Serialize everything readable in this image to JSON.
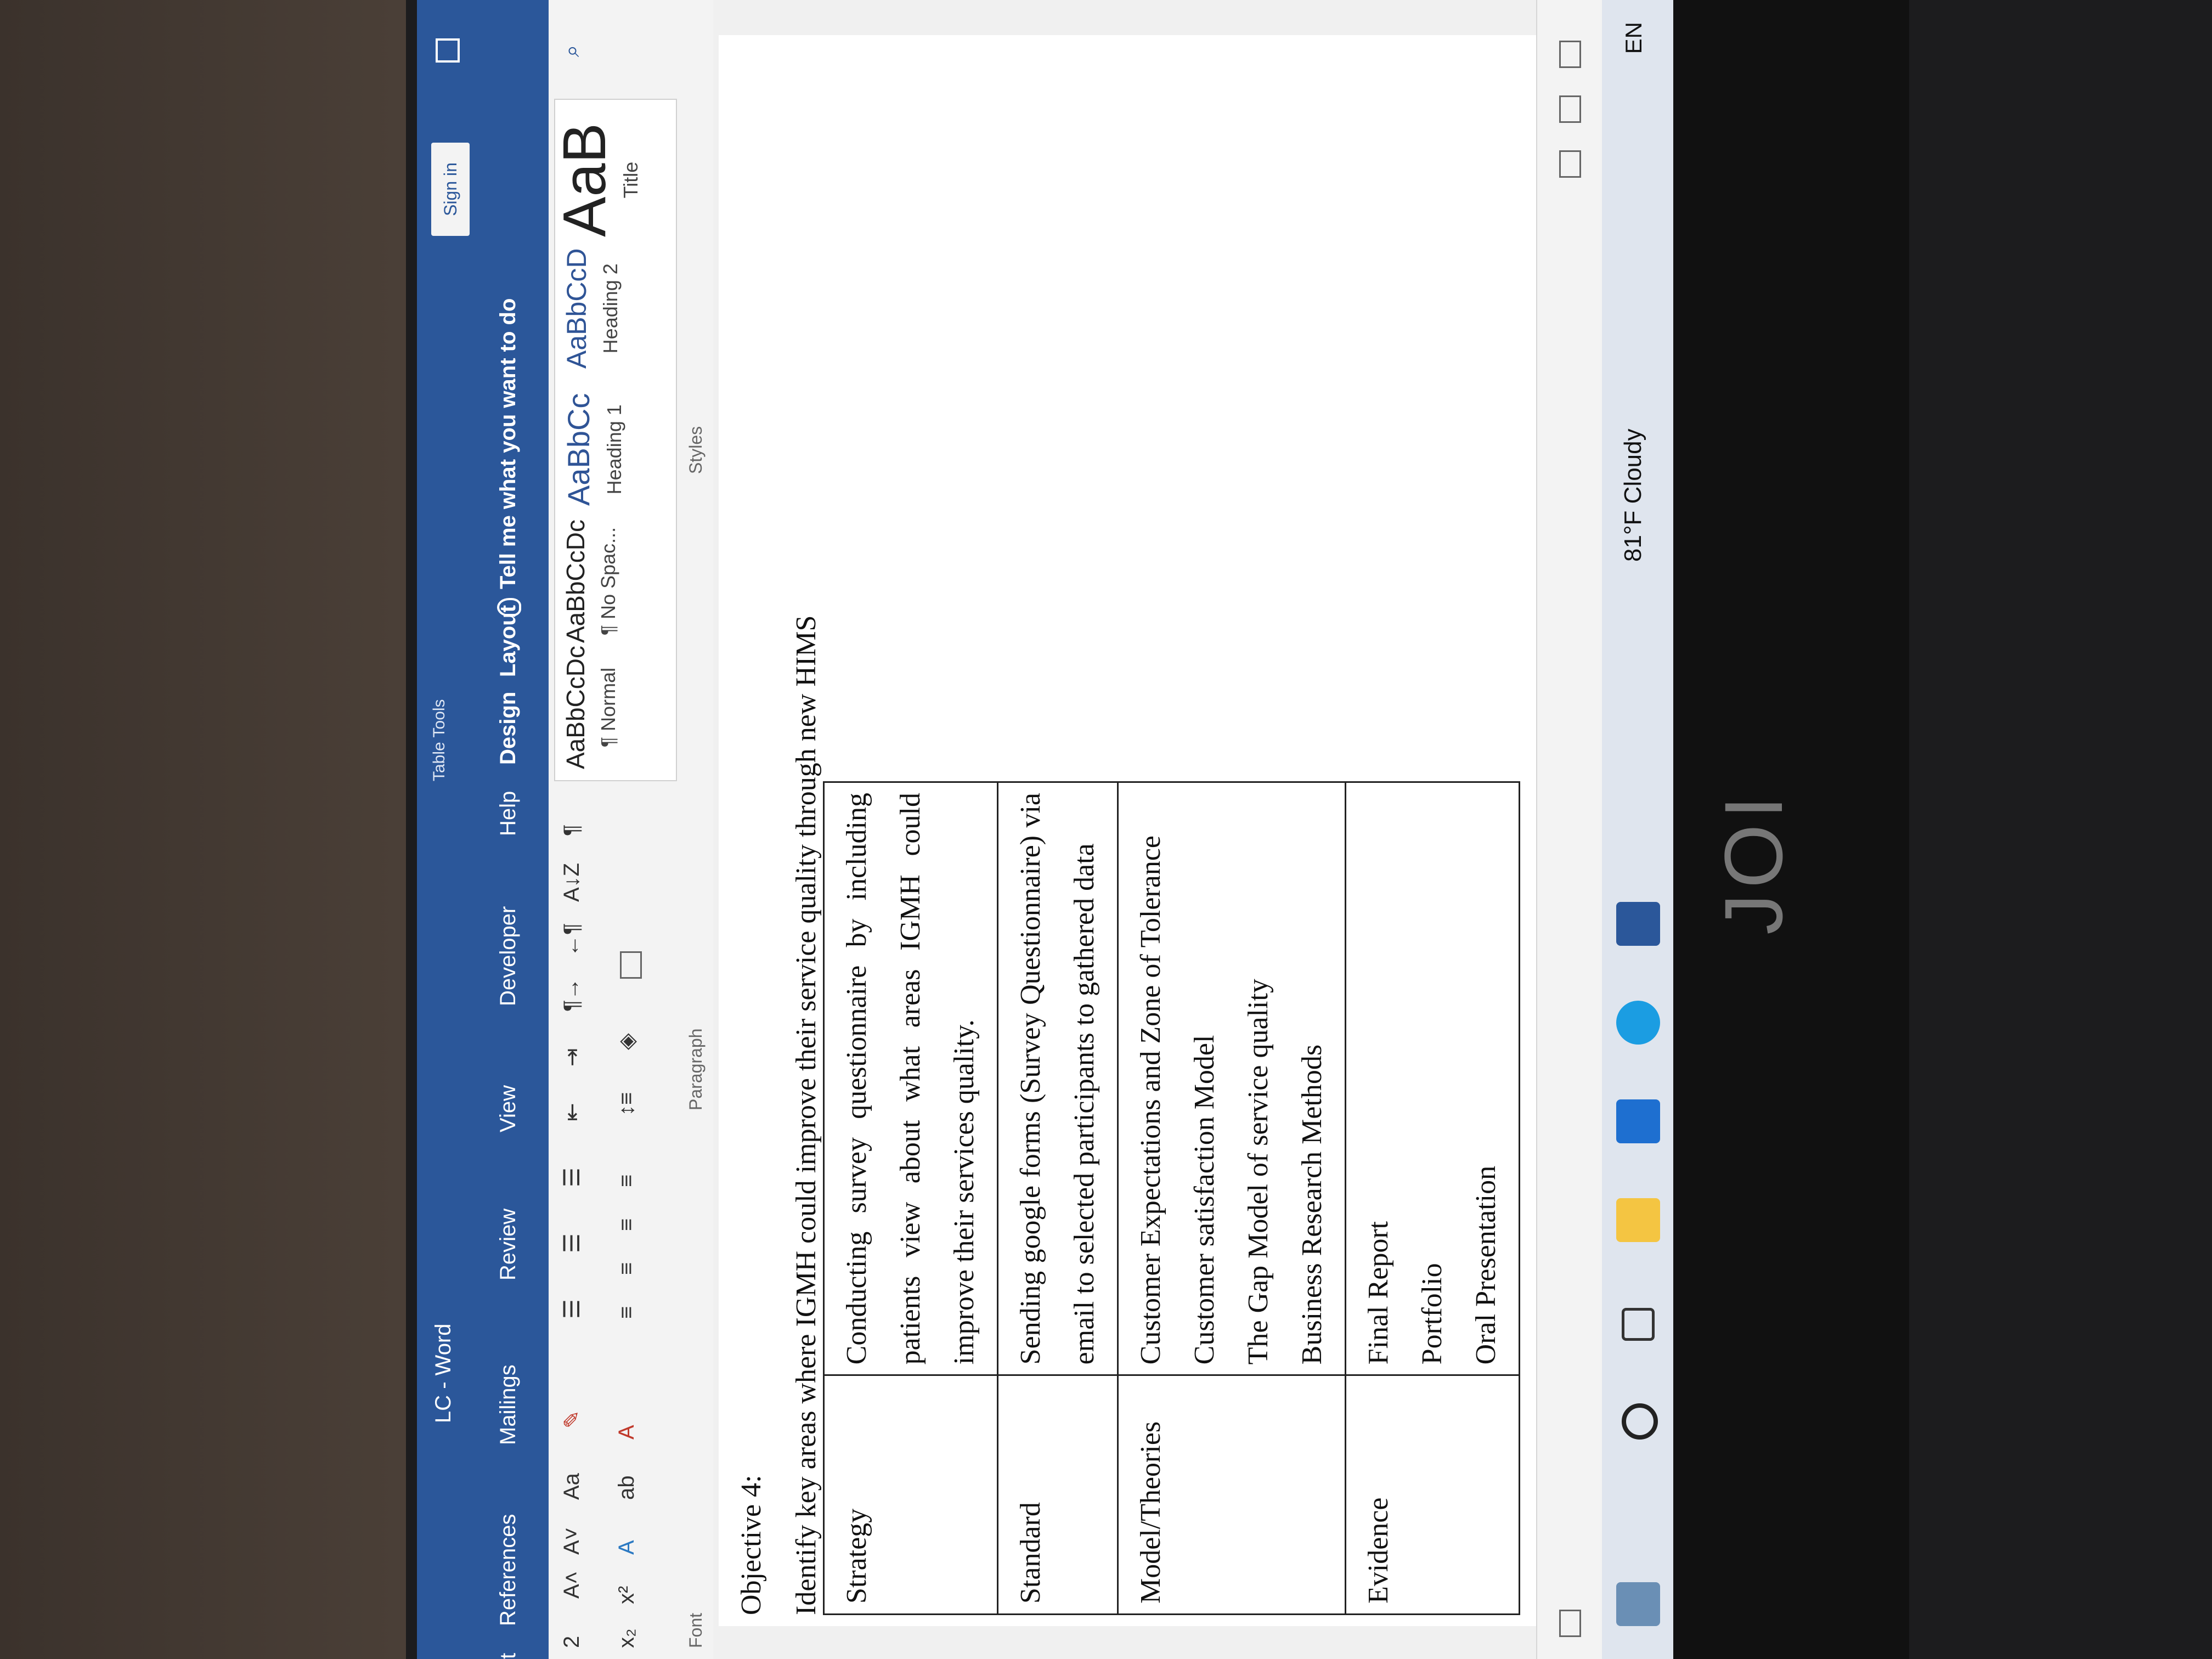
{
  "window": {
    "title": "LC - Word",
    "context_group": "Table Tools",
    "sign_in": "Sign in"
  },
  "tabs": [
    {
      "label": "t"
    },
    {
      "label": "References"
    },
    {
      "label": "Mailings"
    },
    {
      "label": "Review"
    },
    {
      "label": "View"
    },
    {
      "label": "Developer"
    },
    {
      "label": "Help"
    },
    {
      "label": "Design"
    },
    {
      "label": "Layout"
    }
  ],
  "tell_me": "Tell me what you want to do",
  "ribbon": {
    "font_size": "2",
    "case_label": "Aa",
    "font_group": "Font",
    "paragraph_group": "Paragraph",
    "styles_group": "Styles",
    "styles": [
      {
        "sample": "AaBbCcDc",
        "name": "¶ Normal"
      },
      {
        "sample": "AaBbCcDc",
        "name": "¶ No Spac..."
      },
      {
        "sample": "AaBbCc",
        "name": "Heading 1"
      },
      {
        "sample": "AaBbCcD",
        "name": "Heading 2"
      },
      {
        "sample": "AaB",
        "name": "Title"
      }
    ]
  },
  "document": {
    "objective": "Objective 4:",
    "intro": "Identify key areas where IGMH could improve their service quality through new HIMS",
    "rows": [
      {
        "label": "Strategy",
        "lines": [
          "Conducting survey questionnaire by including patients view about what areas IGMH could improve their services quality."
        ]
      },
      {
        "label": "Standard",
        "lines": [
          "Sending google forms (Survey Questionnaire) via email to selected participants to gathered data"
        ]
      },
      {
        "label": "Model/Theories",
        "lines": [
          "Customer Expectations and Zone of Tolerance",
          "Customer satisfaction Model",
          "The Gap Model of service quality",
          "Business Research Methods"
        ]
      },
      {
        "label": "Evidence",
        "lines": [
          "Final Report",
          "Portfolio",
          "Oral Presentation"
        ]
      }
    ]
  },
  "taskbar": {
    "weather": "81°F  Cloudy",
    "language": "EN"
  },
  "hardware": {
    "brand": "JOI"
  }
}
